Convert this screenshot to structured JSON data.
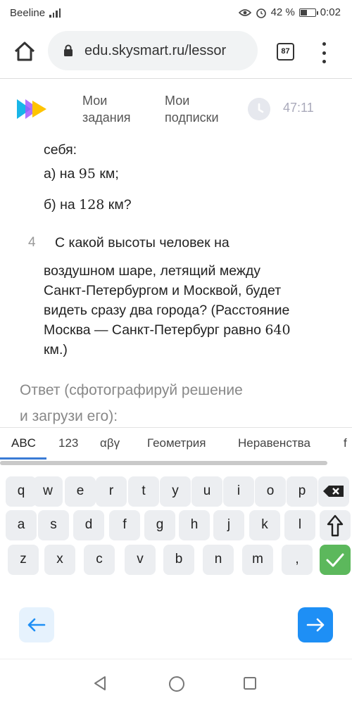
{
  "status": {
    "carrier": "Beeline",
    "network": "4G",
    "battery": "42 %",
    "time": "0:02"
  },
  "browser": {
    "url": "edu.skysmart.ru/lessor",
    "tab_count": "87"
  },
  "app": {
    "nav_tasks": [
      "Мои",
      "задания"
    ],
    "nav_subs": [
      "Мои",
      "подписки"
    ],
    "timer": "47:11"
  },
  "content": {
    "line_top": "себя:",
    "item_a": {
      "pre": "а) на ",
      "num": "95",
      "post": " км;"
    },
    "item_b": {
      "pre": "б) на ",
      "num": "128",
      "post": " км?"
    },
    "question": {
      "number": "4",
      "line1": "С какой высоты человек на",
      "line2": "воздушном шаре, летящий между",
      "line3": "Санкт-Петербургом и Москвой, будет",
      "line4": "видеть сразу два города? (Расстояние",
      "line5_pre": "Москва — Санкт-Петербург равно ",
      "line5_num": "640",
      "line6": "км.)"
    },
    "answer_line1": "Ответ (сфотографируй решение",
    "answer_line2": "и загрузи его):"
  },
  "keyboard": {
    "tabs": [
      "ABC",
      "123",
      "αβγ",
      "Геометрия",
      "Неравенства",
      "f"
    ],
    "active_tab": "ABC",
    "row1": [
      "q",
      "w",
      "e",
      "r",
      "t",
      "y",
      "u",
      "i",
      "o",
      "p"
    ],
    "row2": [
      "a",
      "s",
      "d",
      "f",
      "g",
      "h",
      "j",
      "k",
      "l"
    ],
    "row3": [
      "z",
      "x",
      "c",
      "v",
      "b",
      "n",
      "m",
      ","
    ],
    "icons": {
      "backspace": "backspace-icon",
      "shift": "shift-icon",
      "enter": "checkmark-icon",
      "left": "arrow-left-icon",
      "right": "arrow-right-icon"
    }
  },
  "colors": {
    "accent": "#3a7bd5",
    "enter_green": "#5cb85c",
    "arrow_right_bg": "#1e8ff5",
    "arrow_left_bg": "#e6f2fd"
  }
}
